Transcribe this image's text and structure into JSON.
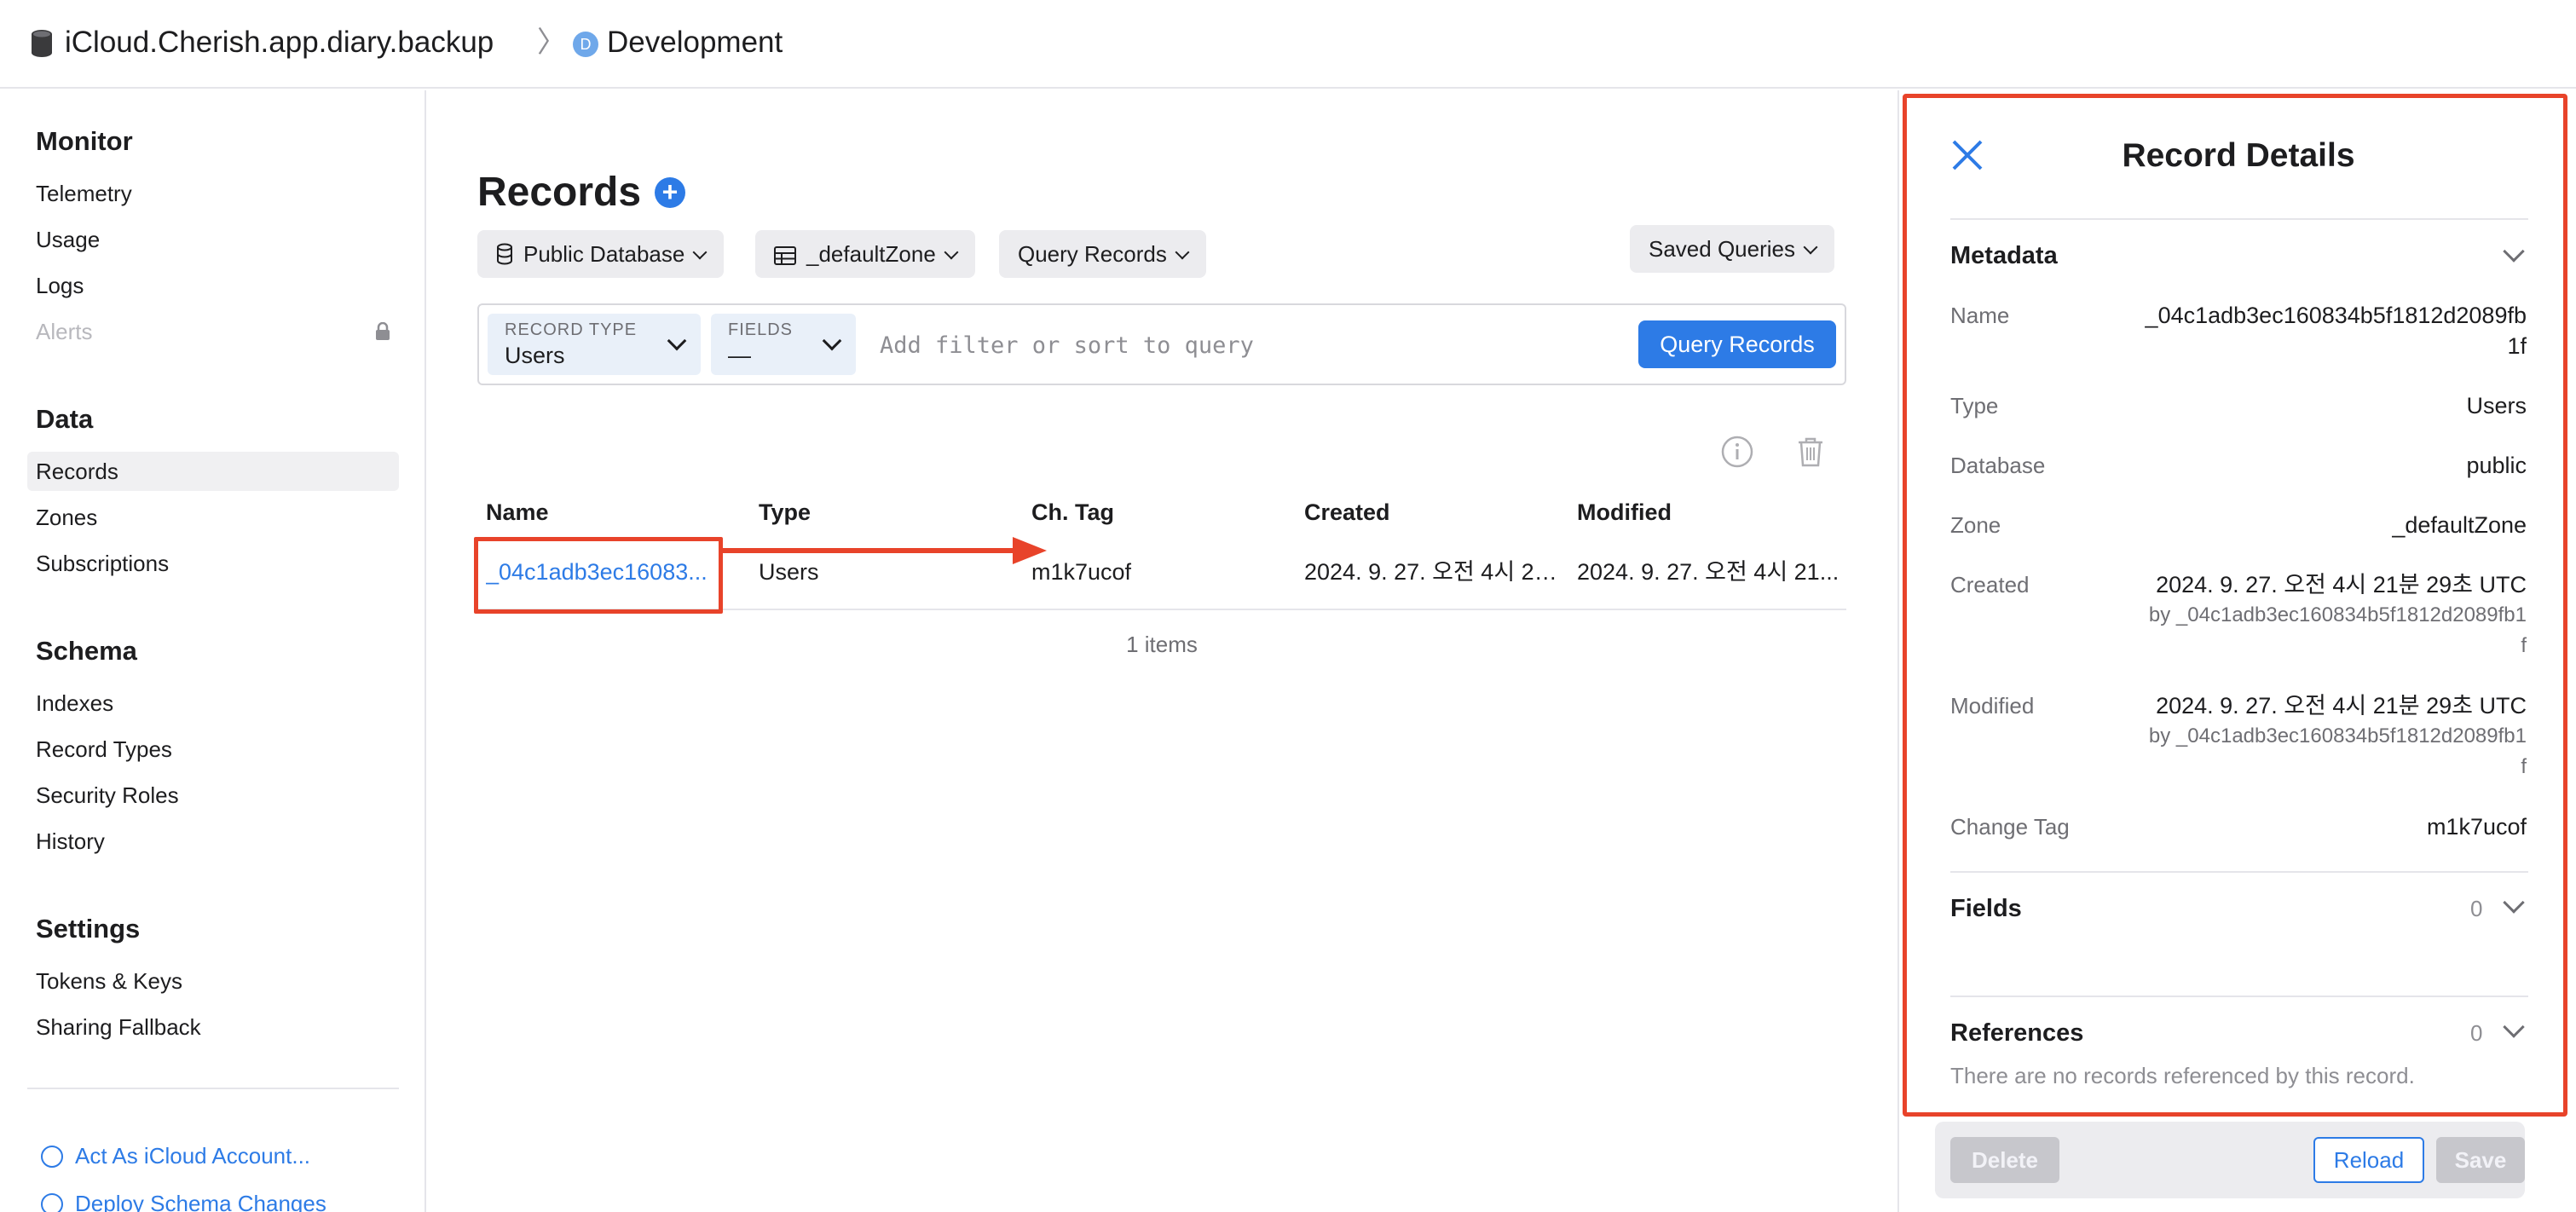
{
  "header": {
    "container_name": "iCloud.Cherish.app.diary.backup",
    "separator": "〉",
    "environment_badge": "D",
    "environment": "Development"
  },
  "sidebar": {
    "sections": [
      {
        "title": "Monitor",
        "items": [
          "Telemetry",
          "Usage",
          "Logs",
          "Alerts"
        ]
      },
      {
        "title": "Data",
        "items": [
          "Records",
          "Zones",
          "Subscriptions"
        ]
      },
      {
        "title": "Schema",
        "items": [
          "Indexes",
          "Record Types",
          "Security Roles",
          "History"
        ]
      },
      {
        "title": "Settings",
        "items": [
          "Tokens & Keys",
          "Sharing Fallback"
        ]
      }
    ],
    "active_item": "Records",
    "disabled_item": "Alerts",
    "actions": [
      "Act As iCloud Account...",
      "Deploy Schema Changes"
    ]
  },
  "main": {
    "title": "Records",
    "database_selector": "Public Database",
    "zone_selector": "_defaultZone",
    "query_mode_selector": "Query Records",
    "saved_queries": "Saved Queries",
    "query": {
      "record_type_label": "RECORD TYPE",
      "record_type_value": "Users",
      "fields_label": "FIELDS",
      "fields_value": "—",
      "placeholder": "Add filter or sort to query",
      "button": "Query Records"
    },
    "table": {
      "columns": [
        "Name",
        "Type",
        "Ch. Tag",
        "Created",
        "Modified"
      ],
      "rows": [
        {
          "name": "_04c1adb3ec16083...",
          "type": "Users",
          "change_tag": "m1k7ucof",
          "created": "2024. 9. 27. 오전 4시 21...",
          "modified": "2024. 9. 27. 오전 4시 21..."
        }
      ],
      "count": "1 items"
    }
  },
  "details": {
    "title": "Record Details",
    "metadata_title": "Metadata",
    "name_label": "Name",
    "name_value_line1": "_04c1adb3ec160834b5f1812d2089fb",
    "name_value_line2": "1f",
    "type_label": "Type",
    "type_value": "Users",
    "database_label": "Database",
    "database_value": "public",
    "zone_label": "Zone",
    "zone_value": "_defaultZone",
    "created_label": "Created",
    "created_value": "2024. 9. 27. 오전 4시 21분 29초 UTC",
    "created_by_line1": "by _04c1adb3ec160834b5f1812d2089fb1",
    "created_by_line2": "f",
    "modified_label": "Modified",
    "modified_value": "2024. 9. 27. 오전 4시 21분 29초 UTC",
    "modified_by_line1": "by _04c1adb3ec160834b5f1812d2089fb1",
    "modified_by_line2": "f",
    "change_tag_label": "Change Tag",
    "change_tag_value": "m1k7ucof",
    "fields_title": "Fields",
    "fields_count": "0",
    "references_title": "References",
    "references_count": "0",
    "no_references": "There are no records referenced by this record.",
    "buttons": {
      "delete": "Delete",
      "reload": "Reload",
      "save": "Save"
    }
  },
  "colors": {
    "accent": "#2d7be6",
    "annotation": "#e8432a"
  }
}
